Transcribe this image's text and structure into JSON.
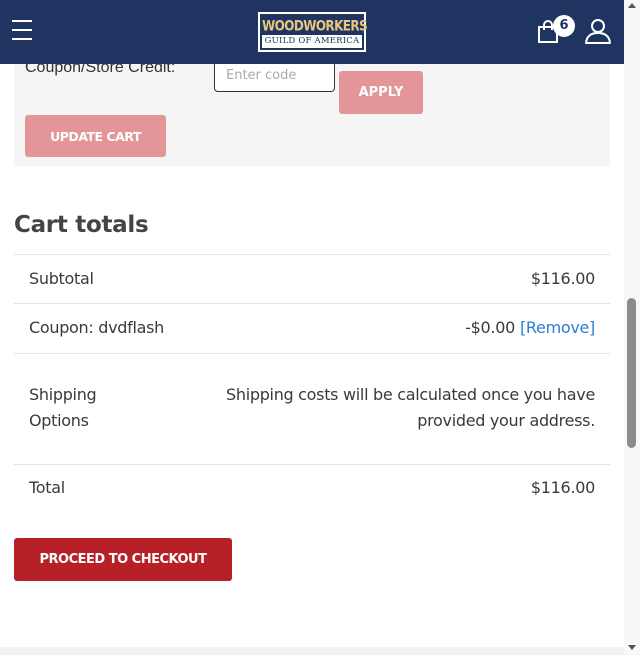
{
  "header": {
    "logo_top": "WOODWORKERS",
    "logo_bottom": "GUILD OF AMERICA",
    "cart_count": "6",
    "icons": {
      "menu": "hamburger-icon",
      "cart": "shopping-bag-icon",
      "account": "user-icon"
    },
    "colors": {
      "background": "#1f3461",
      "logo_gold": "#e8c77d"
    }
  },
  "coupon": {
    "label": "Coupon/Store Credit:",
    "input_placeholder": "Enter code",
    "input_value": "",
    "apply_label": "APPLY",
    "update_cart_label": "UPDATE CART",
    "button_color": "#e39597"
  },
  "totals": {
    "title": "Cart totals",
    "subtotal_label": "Subtotal",
    "subtotal_value": "$116.00",
    "coupon_label": "Coupon: dvdflash",
    "coupon_value": "-$0.00",
    "coupon_remove": "[Remove]",
    "shipping_label": "Shipping Options",
    "shipping_value": "Shipping costs will be calculated once you have provided your address.",
    "total_label": "Total",
    "total_value": "$116.00"
  },
  "checkout": {
    "label": "PROCEED TO CHECKOUT",
    "color": "#b72027"
  }
}
